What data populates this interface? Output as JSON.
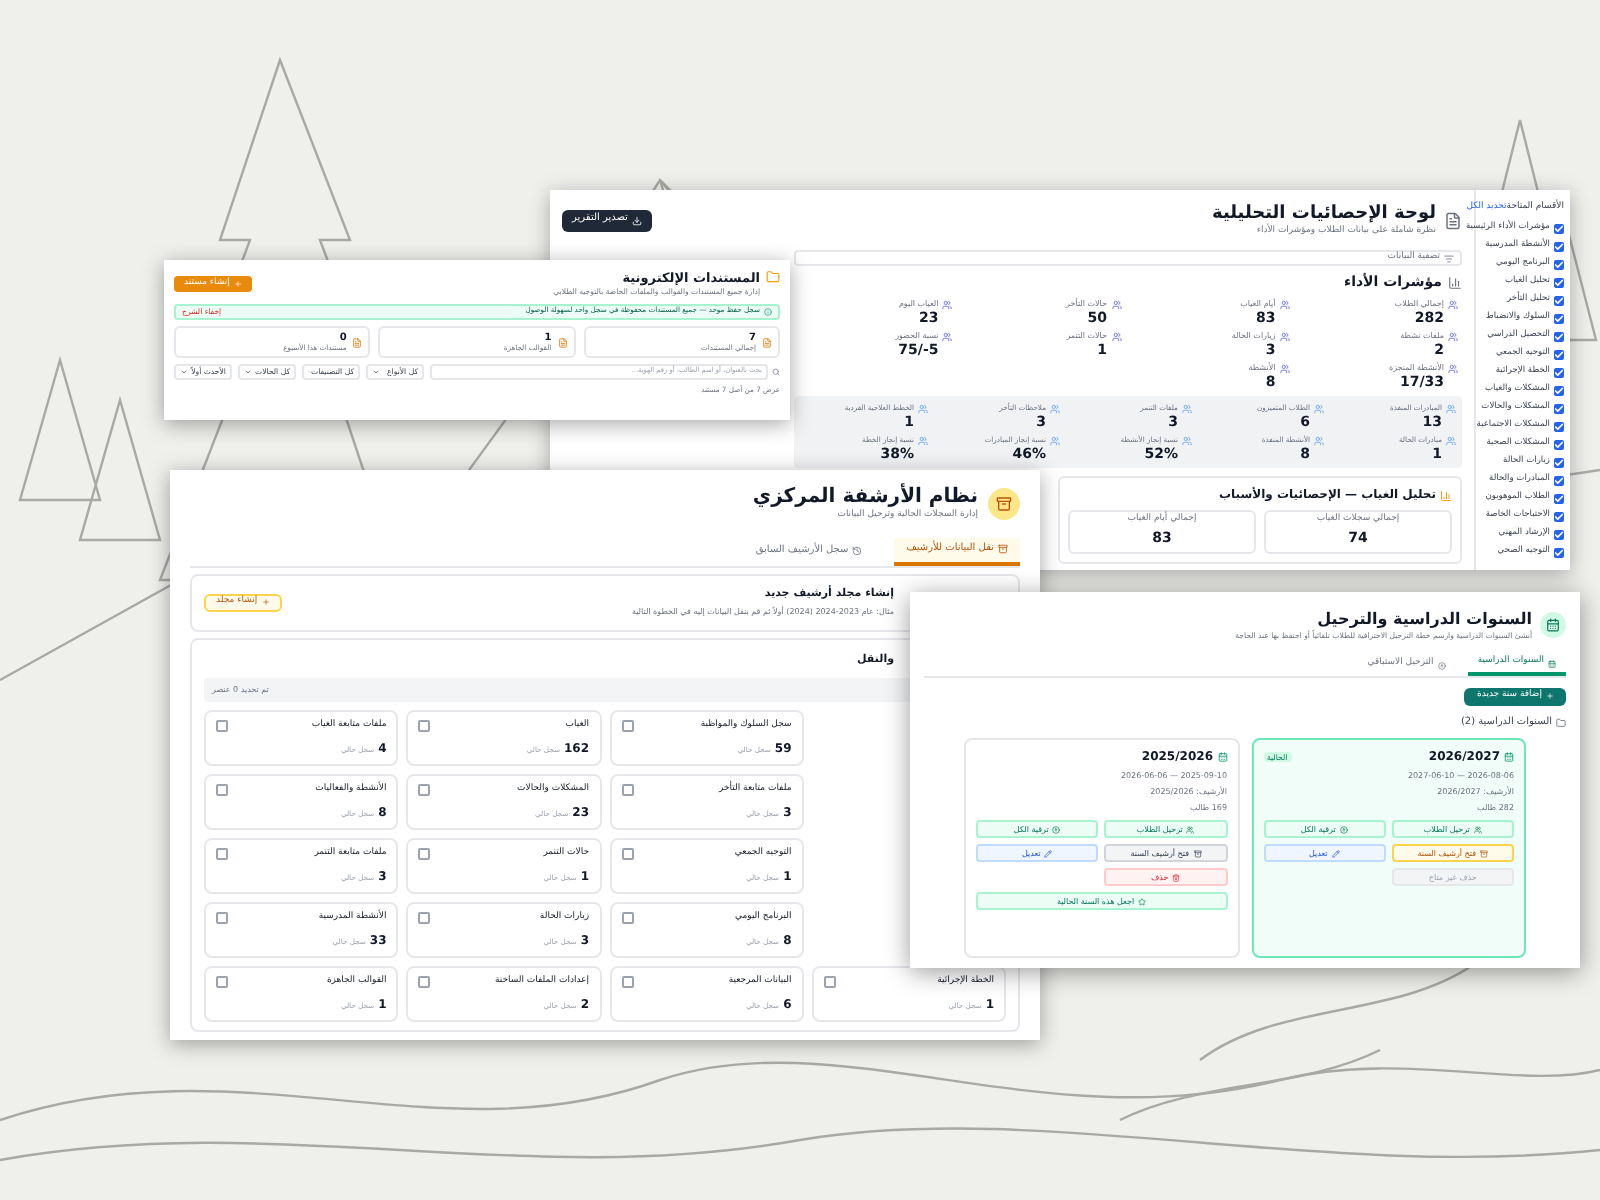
{
  "dashboard": {
    "title": "لوحة الإحصائيات التحليلية",
    "subtitle": "نظرة شاملة على بيانات الطلاب ومؤشرات الأداء",
    "export_button": "تصدير التقرير",
    "filter": "تصفية البيانات",
    "kpi_heading": "مؤشرات الأداء",
    "stats": [
      {
        "label": "إجمالي الطلاب",
        "value": "282"
      },
      {
        "label": "أيام الغياب",
        "value": "83"
      },
      {
        "label": "حالات التأخر",
        "value": "50"
      },
      {
        "label": "الغياب اليوم",
        "value": "23"
      },
      {
        "label": "ملفات نشطة",
        "value": "2"
      },
      {
        "label": "زيارات الحالة",
        "value": "3"
      },
      {
        "label": "حالات التنمر",
        "value": "1"
      },
      {
        "label": "نسبة الحضور",
        "value": "5-/75"
      },
      {
        "label": "الأنشطة المنجزة",
        "value": "17/33"
      },
      {
        "label": "الأنشطة",
        "value": "8"
      }
    ],
    "band": [
      {
        "label": "المبادرات المنفذة",
        "value": "13"
      },
      {
        "label": "الطلاب المتميزون",
        "value": "6"
      },
      {
        "label": "ملفات التنمر",
        "value": "3"
      },
      {
        "label": "ملاحظات التأخر",
        "value": "3"
      },
      {
        "label": "الخطط العلاجية الفردية",
        "value": "1"
      },
      {
        "label": "مبادرات الحالة",
        "value": "1"
      },
      {
        "label": "الأنشطة المنفذة",
        "value": "8"
      },
      {
        "label": "نسبة إنجاز الأنشطة",
        "value": "52%"
      },
      {
        "label": "نسبة إنجاز المبادرات",
        "value": "46%"
      },
      {
        "label": "نسبة إنجاز الخطة",
        "value": "38%"
      }
    ],
    "absence": {
      "heading": "تحليل الغياب — الإحصائيات والأسباب",
      "cards": [
        {
          "label": "إجمالي سجلات الغياب",
          "value": "74"
        },
        {
          "label": "إجمالي أيام الغياب",
          "value": "83"
        }
      ]
    },
    "sidebar": {
      "title": "الأقسام المتاحة",
      "select_all": "تحديد الكل",
      "items": [
        {
          "label": "مؤشرات الأداء الرئيسية",
          "checked": true
        },
        {
          "label": "الأنشطة المدرسية",
          "checked": true
        },
        {
          "label": "البرنامج اليومي",
          "checked": true
        },
        {
          "label": "تحليل الغياب",
          "checked": true
        },
        {
          "label": "تحليل التأخر",
          "checked": true
        },
        {
          "label": "السلوك والانضباط",
          "checked": true
        },
        {
          "label": "التحصيل الدراسي",
          "checked": true
        },
        {
          "label": "التوجيه الجمعي",
          "checked": true
        },
        {
          "label": "الخطة الإجرائية",
          "checked": true
        },
        {
          "label": "المشكلات والغياب",
          "checked": true
        },
        {
          "label": "المشكلات والحالات",
          "checked": true
        },
        {
          "label": "المشكلات الاجتماعية",
          "checked": true
        },
        {
          "label": "المشكلات الصحية",
          "checked": true
        },
        {
          "label": "زيارات الحالة",
          "checked": true
        },
        {
          "label": "المبادرات والحالة",
          "checked": true
        },
        {
          "label": "الطلاب الموهوبون",
          "checked": true
        },
        {
          "label": "الاحتياجات الخاصة",
          "checked": true
        },
        {
          "label": "الإرشاد المهني",
          "checked": true
        },
        {
          "label": "التوجيه الصحي",
          "checked": true
        }
      ]
    }
  },
  "documents": {
    "title": "المستندات الإلكترونية",
    "subtitle": "إدارة جميع المستندات والقوالب والملفات الخاصة بالتوجيه الطلابي",
    "create_button": "إنشاء مستند",
    "banner": "سجل حفظ موحد — جميع المستندات محفوظة في سجل واحد لسهولة الوصول",
    "hide_link": "إخفاء الشرح",
    "stats": [
      {
        "value": "7",
        "label": "إجمالي المستندات"
      },
      {
        "value": "1",
        "label": "القوالب الجاهزة"
      },
      {
        "value": "0",
        "label": "مستندات هذا الأسبوع"
      }
    ],
    "search_placeholder": "بحث بالعنوان، أو اسم الطالب، أو رقم الهوية...",
    "filters": [
      "كل الأنواع",
      "كل التصنيفات",
      "كل الحالات",
      "الأحدث أولاً"
    ],
    "footer": "عرض 7 من أصل 7 مستند"
  },
  "archive": {
    "title": "نظام الأرشفة المركزي",
    "subtitle": "إدارة السجلات الحالية وترحيل البيانات",
    "tabs": [
      {
        "label": "نقل البيانات للأرشيف",
        "selected": true
      },
      {
        "label": "سجل الأرشيف السابق",
        "selected": false
      }
    ],
    "new_folder": {
      "title": "إنشاء مجلد أرشيف جديد",
      "description": "مثال: عام 2023-2024 (2024) أولاً ثم قم بنقل البيانات إليه في الخطوة التالية",
      "button": "إنشاء مجلد"
    },
    "transfer_heading": "والنقل",
    "selection_status": "تم تحديد 0 عنصر",
    "items": [
      {
        "label": "سجل السلوك والمواظبة",
        "count": "59",
        "suffix": "سجل حالي",
        "checked": false
      },
      {
        "label": "الغياب",
        "count": "162",
        "suffix": "سجل حالي",
        "checked": false
      },
      {
        "label": "ملفات متابعة الغياب",
        "count": "4",
        "suffix": "سجل حالي",
        "checked": false
      },
      {
        "label": "ملفات متابعة التأخر",
        "count": "3",
        "suffix": "سجل حالي",
        "checked": false
      },
      {
        "label": "المشكلات والحالات",
        "count": "23",
        "suffix": "سجل حالي",
        "checked": false
      },
      {
        "label": "الأنشطة والفعاليات",
        "count": "8",
        "suffix": "سجل حالي",
        "checked": false
      },
      {
        "label": "التوجيه الجمعي",
        "count": "1",
        "suffix": "سجل حالي",
        "checked": false
      },
      {
        "label": "حالات التنمر",
        "count": "1",
        "suffix": "سجل حالي",
        "checked": false
      },
      {
        "label": "ملفات متابعة التنمر",
        "count": "3",
        "suffix": "سجل حالي",
        "checked": false
      },
      {
        "label": "البرنامج اليومي",
        "count": "8",
        "suffix": "سجل حالي",
        "checked": false
      },
      {
        "label": "زيارات الحالة",
        "count": "3",
        "suffix": "سجل حالي",
        "checked": false
      },
      {
        "label": "الأنشطة المدرسية",
        "count": "33",
        "suffix": "سجل حالي",
        "checked": false
      },
      {
        "label": "الخطة الإجرائية",
        "count": "1",
        "suffix": "سجل حالي",
        "checked": false
      },
      {
        "label": "البيانات المرجعية",
        "count": "6",
        "suffix": "سجل حالي",
        "checked": false
      },
      {
        "label": "إعدادات الملفات الساخنة",
        "count": "2",
        "suffix": "سجل حالي",
        "checked": false
      },
      {
        "label": "القوالب الجاهزة",
        "count": "1",
        "suffix": "سجل حالي",
        "checked": false
      }
    ]
  },
  "years": {
    "title": "السنوات الدراسية والترحيل",
    "subtitle": "أنشئ السنوات الدراسية وارسم خطة الترحيل الاحترافية للطلاب تلقائياً أو احتفظ بها عند الحاجة",
    "tabs": [
      {
        "label": "السنوات الدراسية",
        "selected": true
      },
      {
        "label": "الترحيل الاستباقي",
        "selected": false
      }
    ],
    "add_button": "إضافة سنة جديدة",
    "folder_label": "السنوات الدراسية (2)",
    "current_badge": "الحالية",
    "cards": [
      {
        "year": "2026/2027",
        "current": true,
        "dates": "2026-08-06 — 2027-06-10",
        "archive": "الأرشيف: 2026/2027",
        "students": "282 طالب",
        "actions": [
          {
            "label": "ترحيل الطلاب",
            "kind": "migrate"
          },
          {
            "label": "ترقية الكل",
            "kind": "upgrade"
          },
          {
            "label": "فتح أرشيف السنة",
            "kind": "archive"
          },
          {
            "label": "تعديل",
            "kind": "edit"
          },
          {
            "label": "حذف غير متاح",
            "kind": "delete_locked"
          }
        ]
      },
      {
        "year": "2025/2026",
        "current": false,
        "dates": "2025-09-10 — 2026-06-06",
        "archive": "الأرشيف: 2025/2026",
        "students": "169 طالب",
        "actions": [
          {
            "label": "ترحيل الطلاب",
            "kind": "migrate"
          },
          {
            "label": "ترقية الكل",
            "kind": "upgrade"
          },
          {
            "label": "فتح أرشيف السنة",
            "kind": "archive"
          },
          {
            "label": "تعديل",
            "kind": "edit"
          },
          {
            "label": "حذف",
            "kind": "delete"
          },
          {
            "label": "اجعل هذه السنة الحالية",
            "kind": "make_current"
          }
        ]
      }
    ]
  }
}
